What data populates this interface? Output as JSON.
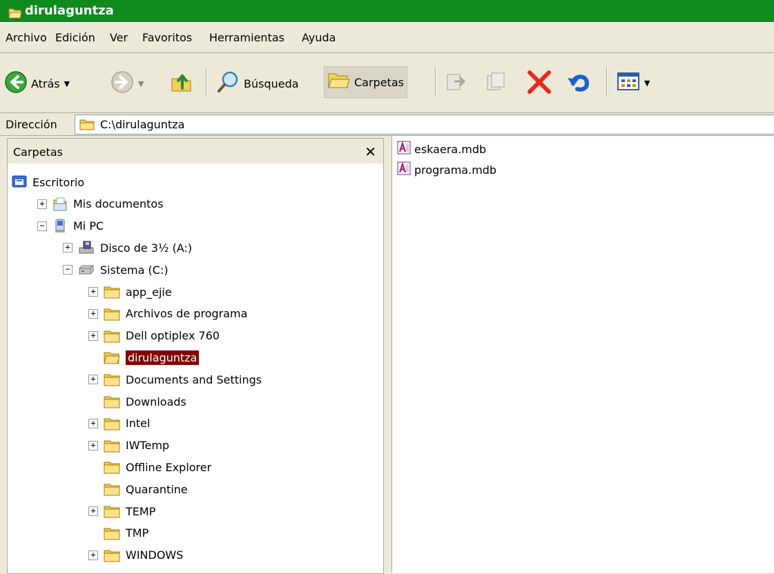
{
  "window": {
    "title": "dirulaguntza"
  },
  "menu": {
    "items": [
      "Archivo",
      "Edición",
      "Ver",
      "Favoritos",
      "Herramientas",
      "Ayuda"
    ]
  },
  "toolbar": {
    "back_label": "Atrás",
    "search_label": "Búsqueda",
    "folders_label": "Carpetas"
  },
  "address": {
    "label": "Dirección",
    "value": "C:\\dirulaguntza"
  },
  "folders_pane": {
    "title": "Carpetas",
    "tree": [
      {
        "label": "Escritorio",
        "icon": "desktop-icon",
        "expander": "none"
      },
      {
        "label": "Mis documentos",
        "icon": "my-documents-icon",
        "expander": "+"
      },
      {
        "label": "Mi PC",
        "icon": "my-computer-icon",
        "expander": "-"
      },
      {
        "label": "Disco de 3½ (A:)",
        "icon": "floppy-drive-icon",
        "expander": "+"
      },
      {
        "label": "Sistema (C:)",
        "icon": "hard-drive-icon",
        "expander": "-"
      },
      {
        "label": "app_ejie",
        "icon": "folder-icon",
        "expander": "+"
      },
      {
        "label": "Archivos de programa",
        "icon": "folder-icon",
        "expander": "+"
      },
      {
        "label": "Dell optiplex 760",
        "icon": "folder-icon",
        "expander": "+"
      },
      {
        "label": "dirulaguntza",
        "icon": "folder-open-icon",
        "expander": "none",
        "selected": true
      },
      {
        "label": "Documents and Settings",
        "icon": "folder-icon",
        "expander": "+"
      },
      {
        "label": "Downloads",
        "icon": "folder-icon",
        "expander": "none"
      },
      {
        "label": "Intel",
        "icon": "folder-icon",
        "expander": "+"
      },
      {
        "label": "IWTemp",
        "icon": "folder-icon",
        "expander": "+"
      },
      {
        "label": "Offline Explorer",
        "icon": "folder-icon",
        "expander": "none"
      },
      {
        "label": "Quarantine",
        "icon": "folder-icon",
        "expander": "none"
      },
      {
        "label": "TEMP",
        "icon": "folder-icon",
        "expander": "+"
      },
      {
        "label": "TMP",
        "icon": "folder-icon",
        "expander": "none"
      },
      {
        "label": "WINDOWS",
        "icon": "folder-icon",
        "expander": "+"
      }
    ]
  },
  "files": [
    {
      "name": "eskaera.mdb",
      "icon": "access-database-icon"
    },
    {
      "name": "programa.mdb",
      "icon": "access-database-icon"
    }
  ],
  "colors": {
    "titlebar": "#0f8a1c",
    "selection": "#800000",
    "chrome": "#ece9d8"
  }
}
